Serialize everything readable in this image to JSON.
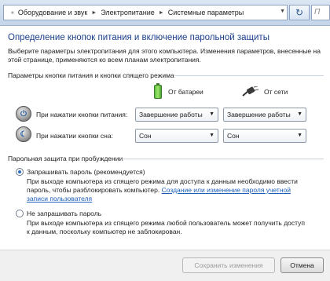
{
  "address": {
    "crumbs": [
      "Оборудование и звук",
      "Электропитание",
      "Системные параметры"
    ],
    "search_placeholder": "П"
  },
  "page": {
    "title": "Определение кнопок питания и включение парольной защиты",
    "intro": "Выберите параметры электропитания для этого компьютера. Изменения параметров, внесенные на этой странице, применяются ко всем планам электропитания."
  },
  "buttons_section": {
    "label": "Параметры кнопки питания и кнопки спящего режима",
    "col_battery": "От батареи",
    "col_ac": "От сети",
    "rows": [
      {
        "label": "При нажатии кнопки питания:",
        "battery": "Завершение работы",
        "ac": "Завершение работы"
      },
      {
        "label": "При нажатии кнопки сна:",
        "battery": "Сон",
        "ac": "Сон"
      }
    ]
  },
  "password_section": {
    "label": "Парольная защита при пробуждении",
    "options": [
      {
        "label": "Запрашивать пароль (рекомендуется)",
        "desc": "При выходе компьютера из спящего режима для доступа к данным необходимо ввести пароль, чтобы разблокировать компьютер.",
        "link": "Создание или изменение пароля учетной записи пользователя",
        "checked": true
      },
      {
        "label": "Не запрашивать пароль",
        "desc": "При выходе компьютера из спящего режима любой пользователь может получить доступ к данным, поскольку компьютер не заблокирован.",
        "checked": false
      }
    ]
  },
  "footer": {
    "save_label": "Сохранить изменения",
    "cancel_label": "Отмена"
  },
  "colors": {
    "title": "#1a3f8a",
    "link": "#1d5fb8"
  }
}
